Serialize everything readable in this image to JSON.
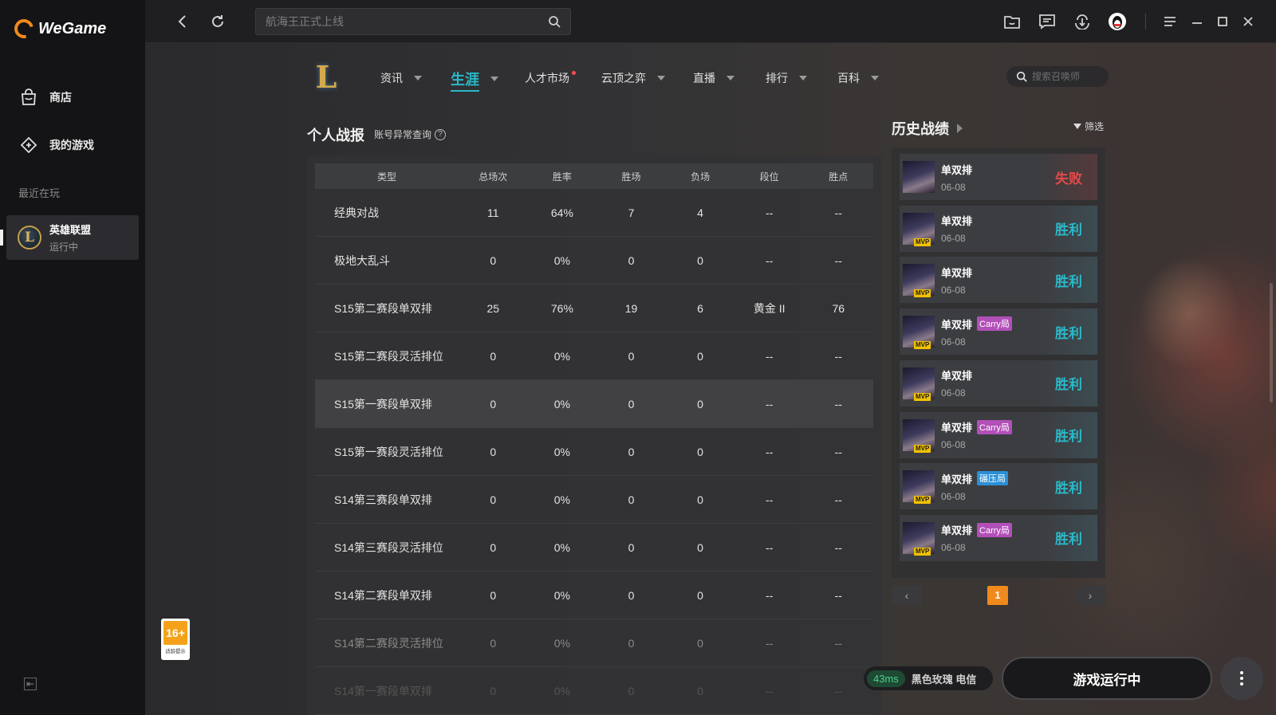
{
  "app": {
    "name": "WeGame"
  },
  "sidebar": {
    "nav": [
      {
        "label": "商店",
        "icon": "shop-bag-icon"
      },
      {
        "label": "我的游戏",
        "icon": "games-icon"
      }
    ],
    "recent_label": "最近在玩",
    "recent_game": {
      "name": "英雄联盟",
      "status": "运行中"
    },
    "age_rating": {
      "label": "16+",
      "sub": "适龄提示"
    }
  },
  "topbar": {
    "search_placeholder": "航海王正式上线"
  },
  "game_nav": {
    "tabs": [
      {
        "label": "资讯",
        "dropdown": true
      },
      {
        "label": "生涯",
        "dropdown": true,
        "active": true
      },
      {
        "label": "人才市场",
        "dropdown": false,
        "dot": true
      },
      {
        "label": "云顶之弈",
        "dropdown": true
      },
      {
        "label": "直播",
        "dropdown": true
      },
      {
        "label": "排行",
        "dropdown": true
      },
      {
        "label": "百科",
        "dropdown": true
      }
    ],
    "summoner_search_placeholder": "搜索召唤师"
  },
  "report": {
    "title": "个人战报",
    "abnormal_link": "账号异常查询",
    "columns": [
      "类型",
      "总场次",
      "胜率",
      "胜场",
      "负场",
      "段位",
      "胜点"
    ],
    "rows": [
      [
        "经典对战",
        "11",
        "64%",
        "7",
        "4",
        "--",
        "--"
      ],
      [
        "极地大乱斗",
        "0",
        "0%",
        "0",
        "0",
        "--",
        "--"
      ],
      [
        "S15第二赛段单双排",
        "25",
        "76%",
        "19",
        "6",
        "黄金 II",
        "76"
      ],
      [
        "S15第二赛段灵活排位",
        "0",
        "0%",
        "0",
        "0",
        "--",
        "--"
      ],
      [
        "S15第一赛段单双排",
        "0",
        "0%",
        "0",
        "0",
        "--",
        "--"
      ],
      [
        "S15第一赛段灵活排位",
        "0",
        "0%",
        "0",
        "0",
        "--",
        "--"
      ],
      [
        "S14第三赛段单双排",
        "0",
        "0%",
        "0",
        "0",
        "--",
        "--"
      ],
      [
        "S14第三赛段灵活排位",
        "0",
        "0%",
        "0",
        "0",
        "--",
        "--"
      ],
      [
        "S14第二赛段单双排",
        "0",
        "0%",
        "0",
        "0",
        "--",
        "--"
      ],
      [
        "S14第二赛段灵活排位",
        "0",
        "0%",
        "0",
        "0",
        "--",
        "--"
      ],
      [
        "S14第一赛段单双排",
        "0",
        "0%",
        "0",
        "0",
        "--",
        "--"
      ]
    ]
  },
  "history": {
    "title": "历史战绩",
    "filter_label": "筛选",
    "matches": [
      {
        "mode": "单双排",
        "date": "06-08",
        "result": "失败",
        "win": false,
        "mvp": false,
        "tag": ""
      },
      {
        "mode": "单双排",
        "date": "06-08",
        "result": "胜利",
        "win": true,
        "mvp": true,
        "tag": ""
      },
      {
        "mode": "单双排",
        "date": "06-08",
        "result": "胜利",
        "win": true,
        "mvp": true,
        "tag": ""
      },
      {
        "mode": "单双排",
        "date": "06-08",
        "result": "胜利",
        "win": true,
        "mvp": true,
        "tag": "Carry局",
        "tag_type": "carry"
      },
      {
        "mode": "单双排",
        "date": "06-08",
        "result": "胜利",
        "win": true,
        "mvp": true,
        "tag": ""
      },
      {
        "mode": "单双排",
        "date": "06-08",
        "result": "胜利",
        "win": true,
        "mvp": true,
        "tag": "Carry局",
        "tag_type": "carry"
      },
      {
        "mode": "单双排",
        "date": "06-08",
        "result": "胜利",
        "win": true,
        "mvp": true,
        "tag": "碾压局",
        "tag_type": "crush"
      },
      {
        "mode": "单双排",
        "date": "06-08",
        "result": "胜利",
        "win": true,
        "mvp": true,
        "tag": "Carry局",
        "tag_type": "carry"
      }
    ],
    "mvp_label": "MVP",
    "pager": {
      "current": "1",
      "prev": "‹",
      "next": "›"
    }
  },
  "bottom": {
    "ping": "43ms",
    "server": "黑色玫瑰 电信",
    "launch_label": "游戏运行中"
  },
  "colors": {
    "accent": "#2ab9c9",
    "brand": "#f08a1c",
    "loss": "#e04a4a",
    "carry": "#b24fb8",
    "crush": "#2b8fd6"
  }
}
